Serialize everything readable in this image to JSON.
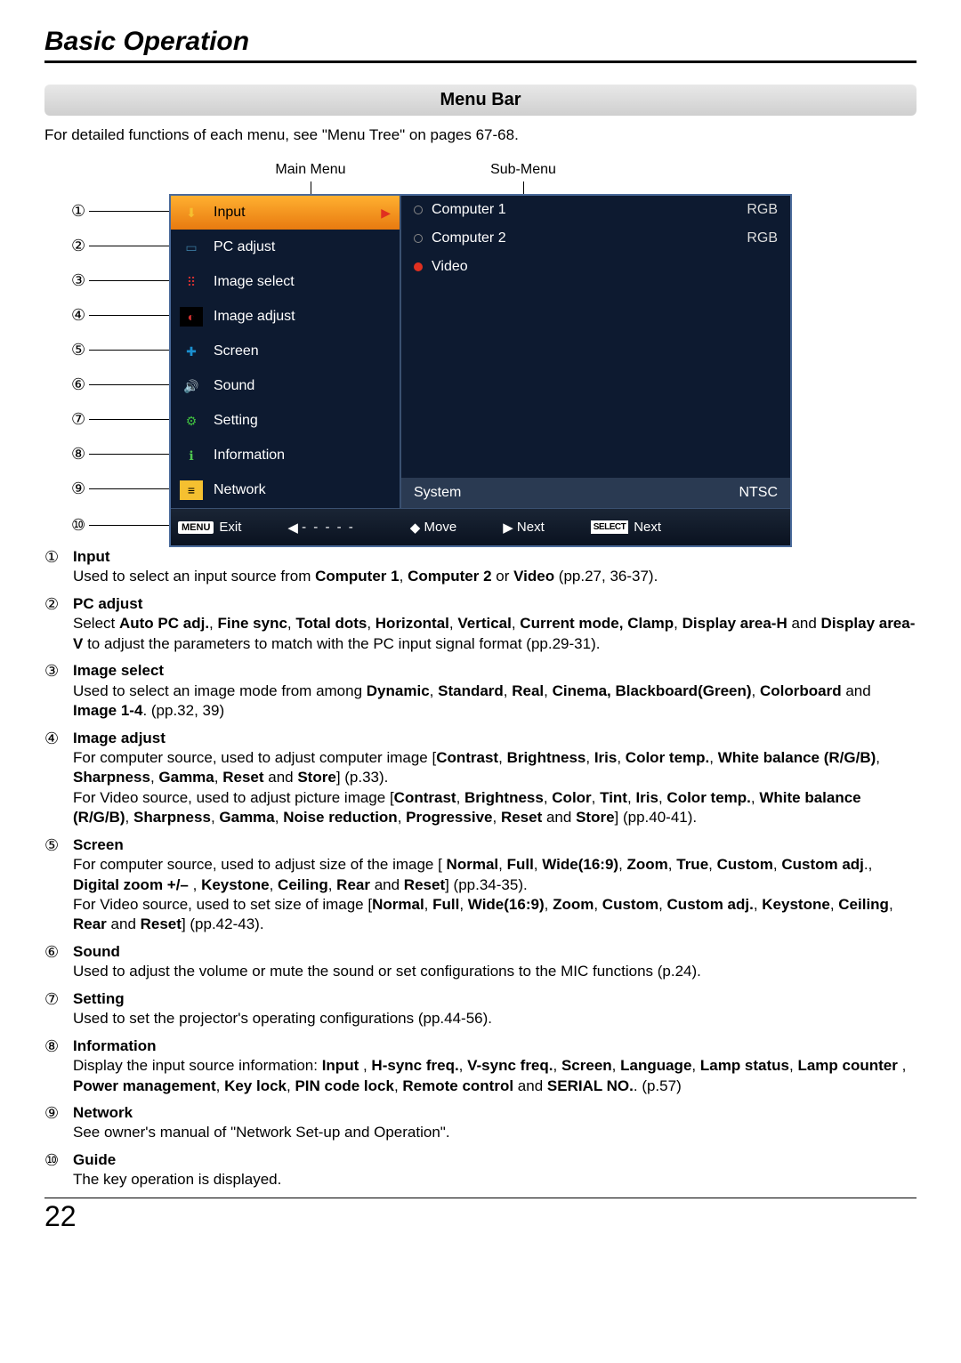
{
  "page_title": "Basic Operation",
  "section_header": "Menu Bar",
  "intro": "For detailed functions of each menu, see \"Menu Tree\" on pages 67-68.",
  "labels": {
    "main": "Main Menu",
    "sub": "Sub-Menu"
  },
  "menu_items": [
    {
      "n": "①",
      "label": "Input",
      "selected": true
    },
    {
      "n": "②",
      "label": "PC adjust"
    },
    {
      "n": "③",
      "label": "Image select"
    },
    {
      "n": "④",
      "label": "Image adjust"
    },
    {
      "n": "⑤",
      "label": "Screen"
    },
    {
      "n": "⑥",
      "label": "Sound"
    },
    {
      "n": "⑦",
      "label": "Setting"
    },
    {
      "n": "⑧",
      "label": "Information"
    },
    {
      "n": "⑨",
      "label": "Network"
    }
  ],
  "sub_items": [
    {
      "label": "Computer 1",
      "value": "RGB",
      "selected": false
    },
    {
      "label": "Computer 2",
      "value": "RGB",
      "selected": false
    },
    {
      "label": "Video",
      "value": "",
      "selected": true
    }
  ],
  "system_row": {
    "label": "System",
    "value": "NTSC"
  },
  "bottom_bar": {
    "n": "⑩",
    "exit_btn": "MENU",
    "exit": "Exit",
    "dashes": "- - - - -",
    "move": "Move",
    "next1": "Next",
    "select_btn": "SELECT",
    "next2": "Next"
  },
  "descriptions": [
    {
      "n": "①",
      "title": "Input",
      "html": "Used to select an input source from <b>Computer 1</b>, <b>Computer 2</b> or <b>Video</b> (pp.27, 36-37)."
    },
    {
      "n": "②",
      "title": "PC adjust",
      "html": "Select <b>Auto PC adj.</b>, <b>Fine sync</b>, <b>Total dots</b>, <b>Horizontal</b>, <b>Vertical</b>, <b>Current mode, Clamp</b>, <b>Display area-H</b> and <b>Display area-V</b> to adjust the parameters to match with the PC input signal format (pp.29-31)."
    },
    {
      "n": "③",
      "title": "Image select",
      "html": "Used to select an image mode from among <b>Dynamic</b>, <b>Standard</b>, <b>Real</b>, <b>Cinema, Blackboard(Green)</b>, <b>Colorboard</b> and <b>Image 1-4</b>. (pp.32, 39)"
    },
    {
      "n": "④",
      "title": "Image adjust",
      "html": "For computer source, used to adjust computer image [<b>Contrast</b>, <b>Brightness</b>, <b>Iris</b>, <b>Color temp.</b>, <b>White balance (R/G/B)</b>, <b>Sharpness</b>, <b>Gamma</b>, <b>Reset</b> and <b>Store</b>] (p.33).<br>For Video source, used to adjust picture image [<b>Contrast</b>, <b>Brightness</b>, <b>Color</b>, <b>Tint</b>, <b>Iris</b>, <b>Color temp.</b>, <b>White balance (R/G/B)</b>, <b>Sharpness</b>, <b>Gamma</b>, <b>Noise reduction</b>, <b>Progressive</b>, <b>Reset</b> and <b>Store</b>] (pp.40-41)."
    },
    {
      "n": "⑤",
      "title": "Screen",
      "html": "For computer source, used to adjust size of the image [ <b>Normal</b>, <b>Full</b>, <b>Wide(16:9)</b>, <b>Zoom</b>, <b>True</b>, <b>Custom</b>, <b>Custom adj</b>., <b>Digital zoom +/–</b> , <b>Keystone</b>, <b>Ceiling</b>, <b>Rear</b> and <b>Reset</b>] (pp.34-35).<br>For Video source, used to set size of image [<b>Normal</b>, <b>Full</b>, <b>Wide(16:9)</b>, <b>Zoom</b>, <b>Custom</b>, <b>Custom adj.</b>, <b>Keystone</b>, <b>Ceiling</b>, <b>Rear</b> and <b>Reset</b>] (pp.42-43)."
    },
    {
      "n": "⑥",
      "title": "Sound",
      "html": "Used to adjust the volume or mute the sound or set configurations to the MIC functions (p.24)."
    },
    {
      "n": "⑦",
      "title": "Setting",
      "html": "Used to set the projector's operating configurations (pp.44-56)."
    },
    {
      "n": "⑧",
      "title": "Information",
      "html": "Display the input source information: <b>Input</b> , <b>H-sync freq.</b>, <b>V-sync freq.</b>, <b>Screen</b>, <b>Language</b>, <b>Lamp status</b>, <b>Lamp counter</b> , <b>Power management</b>, <b>Key lock</b>, <b>PIN code lock</b>, <b>Remote control</b> and <b>SERIAL NO.</b>. (p.57)"
    },
    {
      "n": "⑨",
      "title": "Network",
      "html": "See owner's manual of \"Network Set-up and Operation\"."
    },
    {
      "n": "⑩",
      "title": "Guide",
      "html": "The key operation is displayed."
    }
  ],
  "page_number": "22"
}
